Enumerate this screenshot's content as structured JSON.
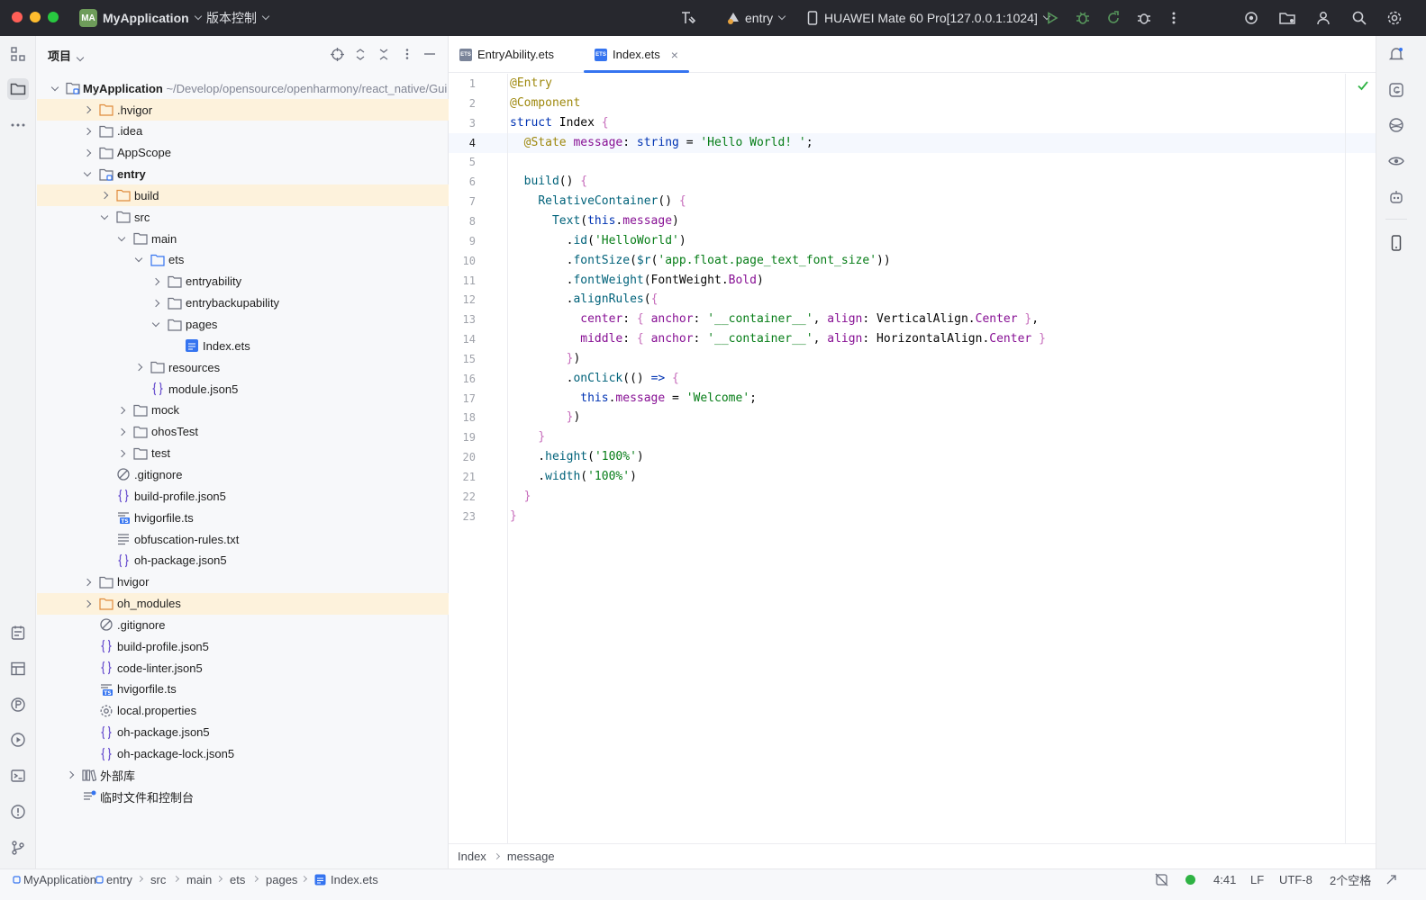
{
  "titlebar": {
    "project_badge": "MA",
    "project_name": "MyApplication",
    "vcs_menu": "版本控制",
    "run_config": "entry",
    "device": "HUAWEI Mate 60 Pro[127.0.0.1:1024]"
  },
  "project_panel": {
    "title": "项目",
    "root_name": "MyApplication",
    "root_path": "~/Develop/opensource/openharmony/react_native/Gui",
    "rows": [
      {
        "label": ".hvigor",
        "indent": 1,
        "arrow": "r",
        "icon": "folder-orange",
        "hl": true
      },
      {
        "label": ".idea",
        "indent": 1,
        "arrow": "r",
        "icon": "folder"
      },
      {
        "label": "AppScope",
        "indent": 1,
        "arrow": "r",
        "icon": "folder"
      },
      {
        "label": "entry",
        "indent": 1,
        "arrow": "d",
        "icon": "module",
        "bold": true
      },
      {
        "label": "build",
        "indent": 2,
        "arrow": "r",
        "icon": "folder-orange",
        "hl": true
      },
      {
        "label": "src",
        "indent": 2,
        "arrow": "d",
        "icon": "folder"
      },
      {
        "label": "main",
        "indent": 3,
        "arrow": "d",
        "icon": "folder"
      },
      {
        "label": "ets",
        "indent": 4,
        "arrow": "d",
        "icon": "folder-blue"
      },
      {
        "label": "entryability",
        "indent": 5,
        "arrow": "r",
        "icon": "folder"
      },
      {
        "label": "entrybackupability",
        "indent": 5,
        "arrow": "r",
        "icon": "folder"
      },
      {
        "label": "pages",
        "indent": 5,
        "arrow": "d",
        "icon": "folder"
      },
      {
        "label": "Index.ets",
        "indent": 6,
        "arrow": "",
        "icon": "ets"
      },
      {
        "label": "resources",
        "indent": 4,
        "arrow": "r",
        "icon": "folder"
      },
      {
        "label": "module.json5",
        "indent": 4,
        "arrow": "",
        "icon": "json"
      },
      {
        "label": "mock",
        "indent": 3,
        "arrow": "r",
        "icon": "folder"
      },
      {
        "label": "ohosTest",
        "indent": 3,
        "arrow": "r",
        "icon": "folder"
      },
      {
        "label": "test",
        "indent": 3,
        "arrow": "r",
        "icon": "folder"
      },
      {
        "label": ".gitignore",
        "indent": 2,
        "arrow": "",
        "icon": "ignore"
      },
      {
        "label": "build-profile.json5",
        "indent": 2,
        "arrow": "",
        "icon": "json"
      },
      {
        "label": "hvigorfile.ts",
        "indent": 2,
        "arrow": "",
        "icon": "ts"
      },
      {
        "label": "obfuscation-rules.txt",
        "indent": 2,
        "arrow": "",
        "icon": "txt"
      },
      {
        "label": "oh-package.json5",
        "indent": 2,
        "arrow": "",
        "icon": "json"
      },
      {
        "label": "hvigor",
        "indent": 1,
        "arrow": "r",
        "icon": "folder"
      },
      {
        "label": "oh_modules",
        "indent": 1,
        "arrow": "r",
        "icon": "folder-orange",
        "hl": true
      },
      {
        "label": ".gitignore",
        "indent": 1,
        "arrow": "",
        "icon": "ignore"
      },
      {
        "label": "build-profile.json5",
        "indent": 1,
        "arrow": "",
        "icon": "json"
      },
      {
        "label": "code-linter.json5",
        "indent": 1,
        "arrow": "",
        "icon": "json"
      },
      {
        "label": "hvigorfile.ts",
        "indent": 1,
        "arrow": "",
        "icon": "ts"
      },
      {
        "label": "local.properties",
        "indent": 1,
        "arrow": "",
        "icon": "gear"
      },
      {
        "label": "oh-package.json5",
        "indent": 1,
        "arrow": "",
        "icon": "json"
      },
      {
        "label": "oh-package-lock.json5",
        "indent": 1,
        "arrow": "",
        "icon": "json"
      },
      {
        "label": "外部库",
        "indent": 0,
        "arrow": "r",
        "icon": "library"
      },
      {
        "label": "临时文件和控制台",
        "indent": 0,
        "arrow": "",
        "icon": "scratch"
      }
    ]
  },
  "editor": {
    "tabs": [
      {
        "label": "EntryAbility.ets",
        "active": false
      },
      {
        "label": "Index.ets",
        "active": true
      }
    ],
    "current_line": 4,
    "lines": [
      [
        [
          "an",
          "@Entry"
        ]
      ],
      [
        [
          "an",
          "@Component"
        ]
      ],
      [
        [
          "kw",
          "struct "
        ],
        [
          "pl",
          "Index "
        ],
        [
          "br",
          "{"
        ]
      ],
      [
        [
          "pl",
          "  "
        ],
        [
          "an",
          "@State "
        ],
        [
          "pr",
          "message"
        ],
        [
          "pl",
          ": "
        ],
        [
          "kw",
          "string"
        ],
        [
          "pl",
          " = "
        ],
        [
          "st",
          "'Hello World! '"
        ],
        [
          "pl",
          ";"
        ]
      ],
      [],
      [
        [
          "pl",
          "  "
        ],
        [
          "fn",
          "build"
        ],
        [
          "pl",
          "() "
        ],
        [
          "br",
          "{"
        ]
      ],
      [
        [
          "pl",
          "    "
        ],
        [
          "fn",
          "RelativeContainer"
        ],
        [
          "pl",
          "() "
        ],
        [
          "br",
          "{"
        ]
      ],
      [
        [
          "pl",
          "      "
        ],
        [
          "fn",
          "Text"
        ],
        [
          "pl",
          "("
        ],
        [
          "kw",
          "this"
        ],
        [
          "pl",
          "."
        ],
        [
          "pr",
          "message"
        ],
        [
          "pl",
          ")"
        ]
      ],
      [
        [
          "pl",
          "        ."
        ],
        [
          "fn",
          "id"
        ],
        [
          "pl",
          "("
        ],
        [
          "st",
          "'HelloWorld'"
        ],
        [
          "pl",
          ")"
        ]
      ],
      [
        [
          "pl",
          "        ."
        ],
        [
          "fn",
          "fontSize"
        ],
        [
          "pl",
          "("
        ],
        [
          "fn",
          "$r"
        ],
        [
          "pl",
          "("
        ],
        [
          "st",
          "'app.float.page_text_font_size'"
        ],
        [
          "pl",
          "))"
        ]
      ],
      [
        [
          "pl",
          "        ."
        ],
        [
          "fn",
          "fontWeight"
        ],
        [
          "pl",
          "(FontWeight."
        ],
        [
          "pr",
          "Bold"
        ],
        [
          "pl",
          ")"
        ]
      ],
      [
        [
          "pl",
          "        ."
        ],
        [
          "fn",
          "alignRules"
        ],
        [
          "pl",
          "("
        ],
        [
          "br",
          "{"
        ]
      ],
      [
        [
          "pl",
          "          "
        ],
        [
          "pr",
          "center"
        ],
        [
          "pl",
          ": "
        ],
        [
          "br",
          "{ "
        ],
        [
          "pr",
          "anchor"
        ],
        [
          "pl",
          ": "
        ],
        [
          "st",
          "'__container__'"
        ],
        [
          "pl",
          ", "
        ],
        [
          "pr",
          "align"
        ],
        [
          "pl",
          ": VerticalAlign."
        ],
        [
          "pr",
          "Center "
        ],
        [
          "br",
          "}"
        ],
        [
          "pl",
          ","
        ]
      ],
      [
        [
          "pl",
          "          "
        ],
        [
          "pr",
          "middle"
        ],
        [
          "pl",
          ": "
        ],
        [
          "br",
          "{ "
        ],
        [
          "pr",
          "anchor"
        ],
        [
          "pl",
          ": "
        ],
        [
          "st",
          "'__container__'"
        ],
        [
          "pl",
          ", "
        ],
        [
          "pr",
          "align"
        ],
        [
          "pl",
          ": HorizontalAlign."
        ],
        [
          "pr",
          "Center "
        ],
        [
          "br",
          "}"
        ]
      ],
      [
        [
          "pl",
          "        "
        ],
        [
          "br",
          "}"
        ],
        [
          "pl",
          ")"
        ]
      ],
      [
        [
          "pl",
          "        ."
        ],
        [
          "fn",
          "onClick"
        ],
        [
          "pl",
          "(() "
        ],
        [
          "kw",
          "=> "
        ],
        [
          "br",
          "{"
        ]
      ],
      [
        [
          "pl",
          "          "
        ],
        [
          "kw",
          "this"
        ],
        [
          "pl",
          "."
        ],
        [
          "pr",
          "message"
        ],
        [
          "pl",
          " = "
        ],
        [
          "st",
          "'Welcome'"
        ],
        [
          "pl",
          ";"
        ]
      ],
      [
        [
          "pl",
          "        "
        ],
        [
          "br",
          "}"
        ],
        [
          "pl",
          ")"
        ]
      ],
      [
        [
          "pl",
          "    "
        ],
        [
          "br",
          "}"
        ]
      ],
      [
        [
          "pl",
          "    ."
        ],
        [
          "fn",
          "height"
        ],
        [
          "pl",
          "("
        ],
        [
          "st",
          "'100%'"
        ],
        [
          "pl",
          ")"
        ]
      ],
      [
        [
          "pl",
          "    ."
        ],
        [
          "fn",
          "width"
        ],
        [
          "pl",
          "("
        ],
        [
          "st",
          "'100%'"
        ],
        [
          "pl",
          ")"
        ]
      ],
      [
        [
          "pl",
          "  "
        ],
        [
          "br",
          "}"
        ]
      ],
      [
        [
          "br",
          "}"
        ]
      ]
    ],
    "breadcrumb": [
      "Index",
      "message"
    ]
  },
  "statusbar": {
    "path": [
      "MyApplication",
      "entry",
      "src",
      "main",
      "ets",
      "pages",
      "Index.ets"
    ],
    "position": "4:41",
    "line_sep": "LF",
    "encoding": "UTF-8",
    "indent": "2个空格"
  },
  "colors": {
    "accent": "#3574f0",
    "titlebar": "#27282e",
    "highlight_row": "#fdf2dc",
    "success": "#2fb344"
  }
}
